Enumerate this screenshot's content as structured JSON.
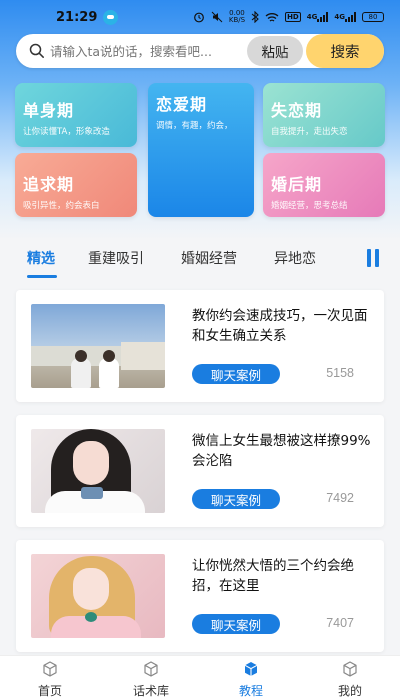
{
  "status_bar": {
    "time": "21:29",
    "net_speed_top": "0.00",
    "net_speed_bottom": "KB/S",
    "hd": "HD",
    "signal": "4G",
    "signal2": "4G",
    "battery": "80"
  },
  "search": {
    "placeholder": "请输入ta说的话，搜索看吧...",
    "paste_label": "粘贴",
    "search_label": "搜索"
  },
  "categories": [
    {
      "title": "单身期",
      "desc": "让你读懂TA，形象改造"
    },
    {
      "title": "恋爱期",
      "desc": "调情，有趣，约会，"
    },
    {
      "title": "失恋期",
      "desc": "自我提升，走出失恋"
    },
    {
      "title": "追求期",
      "desc": "吸引异性，约会表白"
    },
    {
      "title": "婚后期",
      "desc": "婚姻经营，思考总结"
    }
  ],
  "tabs": [
    {
      "label": "精选"
    },
    {
      "label": "重建吸引"
    },
    {
      "label": "婚姻经营"
    },
    {
      "label": "异地恋"
    }
  ],
  "articles": [
    {
      "title": "教你约会速成技巧，一次见面和女生确立关系",
      "button": "聊天案例",
      "views": "5158"
    },
    {
      "title": "微信上女生最想被这样撩99%会沦陷",
      "button": "聊天案例",
      "views": "7492"
    },
    {
      "title": "让你恍然大悟的三个约会绝招，在这里",
      "button": "聊天案例",
      "views": "7407"
    }
  ],
  "bottom_nav": [
    {
      "label": "首页"
    },
    {
      "label": "话术库"
    },
    {
      "label": "教程"
    },
    {
      "label": "我的"
    }
  ],
  "colors": {
    "accent": "#1a7de0",
    "search_button": "#ffd46e"
  }
}
